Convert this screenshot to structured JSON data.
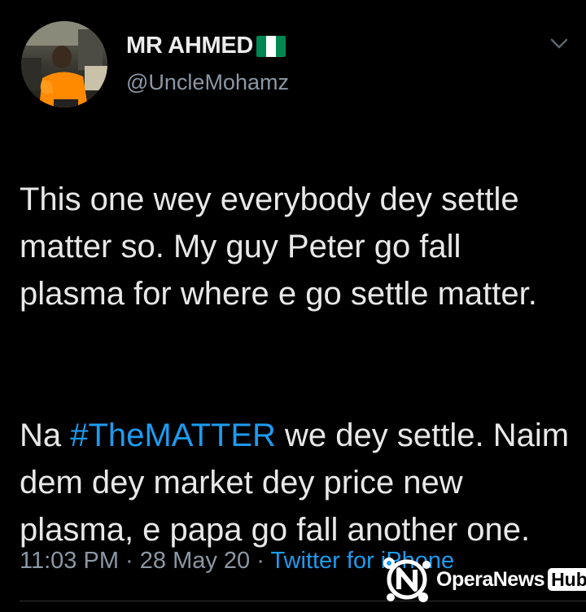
{
  "author": {
    "display_name": "MR AHMED",
    "handle": "@UncleMohamz",
    "flag_colors": [
      "#008751",
      "#ffffff",
      "#008751"
    ]
  },
  "icons": {
    "avatar": "profile-photo",
    "caret": "chevron-down-icon",
    "flag": "nigeria-flag-icon"
  },
  "tweet": {
    "paragraph1": "This one wey everybody dey settle matter so. My guy Peter go fall plasma for where e go settle matter.",
    "paragraph2_prefix": "Na ",
    "hashtag": "#TheMATTER",
    "paragraph2_suffix": " we dey settle. Naim dem dey market dey price new plasma, e papa go fall another one."
  },
  "meta": {
    "time": "11:03 PM",
    "separator": " · ",
    "date": "28 May 20",
    "source": "Twitter for iPhone"
  },
  "watermark": {
    "brand": "OperaNews",
    "badge": "Hub"
  },
  "colors": {
    "background": "#000000",
    "link": "#1d9bf0",
    "secondary_text": "#8b98a5",
    "primary_text": "#e8e8e8"
  }
}
